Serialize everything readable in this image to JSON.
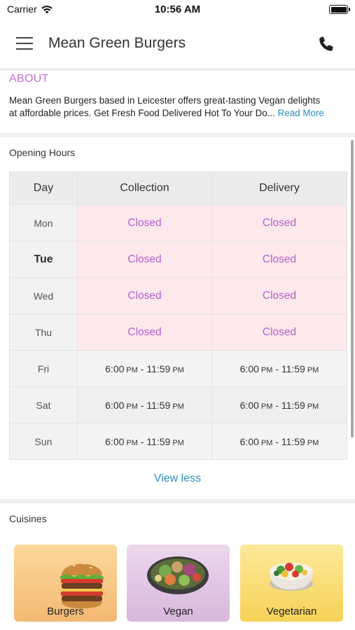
{
  "status_bar": {
    "carrier": "Carrier",
    "time": "10:56 AM"
  },
  "header": {
    "title": "Mean Green Burgers",
    "menu_icon": "hamburger-menu-icon",
    "call_icon": "phone-icon"
  },
  "about": {
    "heading": "ABOUT",
    "line1": "Mean Green Burgers based in Leicester offers great-tasting Vegan delights",
    "line2": "at affordable prices. Get Fresh Food Delivered Hot To Your Do",
    "ellipsis": "...",
    "read_more": "Read More"
  },
  "opening_hours": {
    "label": "Opening Hours",
    "columns": [
      "Day",
      "Collection",
      "Delivery"
    ],
    "rows": [
      {
        "day": "Mon",
        "collection": "Closed",
        "delivery": "Closed"
      },
      {
        "day": "Tue",
        "collection": "Closed",
        "delivery": "Closed"
      },
      {
        "day": "Wed",
        "collection": "Closed",
        "delivery": "Closed"
      },
      {
        "day": "Thu",
        "collection": "Closed",
        "delivery": "Closed"
      },
      {
        "day": "Fri",
        "collection": {
          "start": "6:00",
          "start_ampm": "PM",
          "sep": " - ",
          "end": "11:59",
          "end_ampm": "PM"
        },
        "delivery": {
          "start": "6:00",
          "start_ampm": "PM",
          "sep": " - ",
          "end": "11:59",
          "end_ampm": "PM"
        }
      },
      {
        "day": "Sat",
        "collection": {
          "start": "6:00",
          "start_ampm": "PM",
          "sep": " - ",
          "end": "11:59",
          "end_ampm": "PM"
        },
        "delivery": {
          "start": "6:00",
          "start_ampm": "PM",
          "sep": " - ",
          "end": "11:59",
          "end_ampm": "PM"
        }
      },
      {
        "day": "Sun",
        "collection": {
          "start": "6:00",
          "start_ampm": "PM",
          "sep": " - ",
          "end": "11:59",
          "end_ampm": "PM"
        },
        "delivery": {
          "start": "6:00",
          "start_ampm": "PM",
          "sep": " - ",
          "end": "11:59",
          "end_ampm": "PM"
        }
      }
    ],
    "today": "Tue",
    "view_less": "View less"
  },
  "cuisines": {
    "label": "Cuisines",
    "items": [
      {
        "name": "Burgers",
        "icon": "burger-icon"
      },
      {
        "name": "Vegan",
        "icon": "salad-bowl-icon"
      },
      {
        "name": "Vegetarian",
        "icon": "vegetable-bowl-icon"
      }
    ]
  },
  "colors": {
    "accent_link": "#2a8fc1",
    "closed_text": "#b65fd0",
    "closed_bg": "#fde9ec",
    "about_heading": "#c46fd6"
  }
}
